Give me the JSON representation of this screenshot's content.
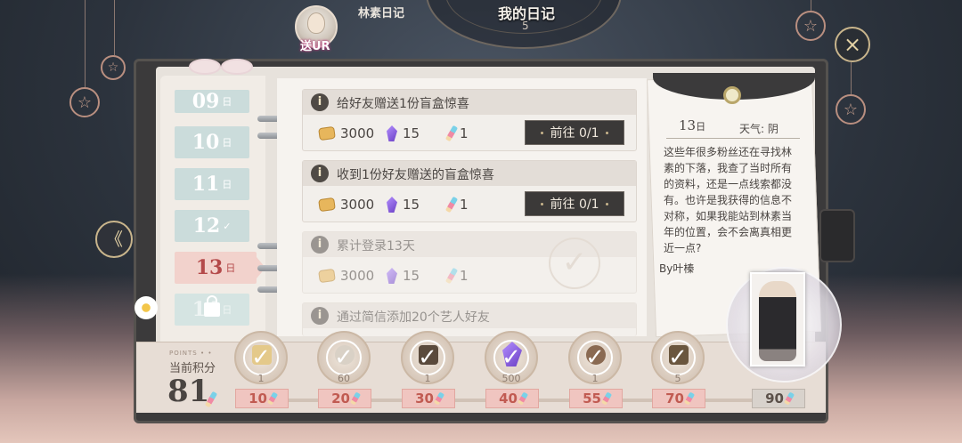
{
  "header": {
    "avatar_badge": "送UR",
    "tab_linsu": "林素日记",
    "tab_diary": "我的日记",
    "clock_numeral": "5"
  },
  "buttons": {
    "close_icon": "×",
    "back_icon": "《"
  },
  "days": {
    "unit": "日",
    "tabs": [
      {
        "day": "09",
        "state": "past"
      },
      {
        "day": "10",
        "state": "past"
      },
      {
        "day": "11",
        "state": "past"
      },
      {
        "day": "12",
        "state": "completed"
      },
      {
        "day": "13",
        "state": "current"
      },
      {
        "day": "14",
        "state": "locked"
      }
    ]
  },
  "tasks": [
    {
      "title": "给好友赠送1份盲盒惊喜",
      "gold": "3000",
      "gems": "15",
      "pens": "1",
      "action": "前往 0/1",
      "done": false
    },
    {
      "title": "收到1份好友赠送的盲盒惊喜",
      "gold": "3000",
      "gems": "15",
      "pens": "1",
      "action": "前往 0/1",
      "done": false
    },
    {
      "title": "累计登录13天",
      "gold": "3000",
      "gems": "15",
      "pens": "1",
      "action": "",
      "done": true
    },
    {
      "title": "通过简信添加20个艺人好友",
      "gold": "",
      "gems": "",
      "pens": "",
      "action": "",
      "done": true
    }
  ],
  "diary_note": {
    "date": "13",
    "date_unit": "日",
    "weather": "天气: 阴",
    "text": "这些年很多粉丝还在寻找林素的下落，我查了当时所有的资料，还是一点线索都没有。也许是我获得的信息不对称，如果我能站到林素当年的位置，会不会离真相更近一点?",
    "signature": "By叶榛"
  },
  "points": {
    "small_label": "POINTS • •",
    "label": "当前积分",
    "value": "81"
  },
  "milestones": [
    {
      "threshold": "10",
      "qty": "1",
      "claimed": true,
      "item": "bouquet"
    },
    {
      "threshold": "20",
      "qty": "60",
      "claimed": true,
      "item": "portrait"
    },
    {
      "threshold": "30",
      "qty": "1",
      "claimed": true,
      "item": "chest"
    },
    {
      "threshold": "40",
      "qty": "500",
      "claimed": true,
      "item": "gem"
    },
    {
      "threshold": "55",
      "qty": "1",
      "claimed": true,
      "item": "portrait"
    },
    {
      "threshold": "70",
      "qty": "5",
      "claimed": true,
      "item": "chest"
    },
    {
      "threshold": "90",
      "qty": "",
      "claimed": false,
      "item": "grand-prize-card"
    }
  ],
  "colors": {
    "accent": "#c15b52",
    "frame": "#3b3a3b",
    "tab_teal": "#cbdcdb",
    "tab_active": "#f2d2cc",
    "gold_trim": "#c9b58c"
  }
}
